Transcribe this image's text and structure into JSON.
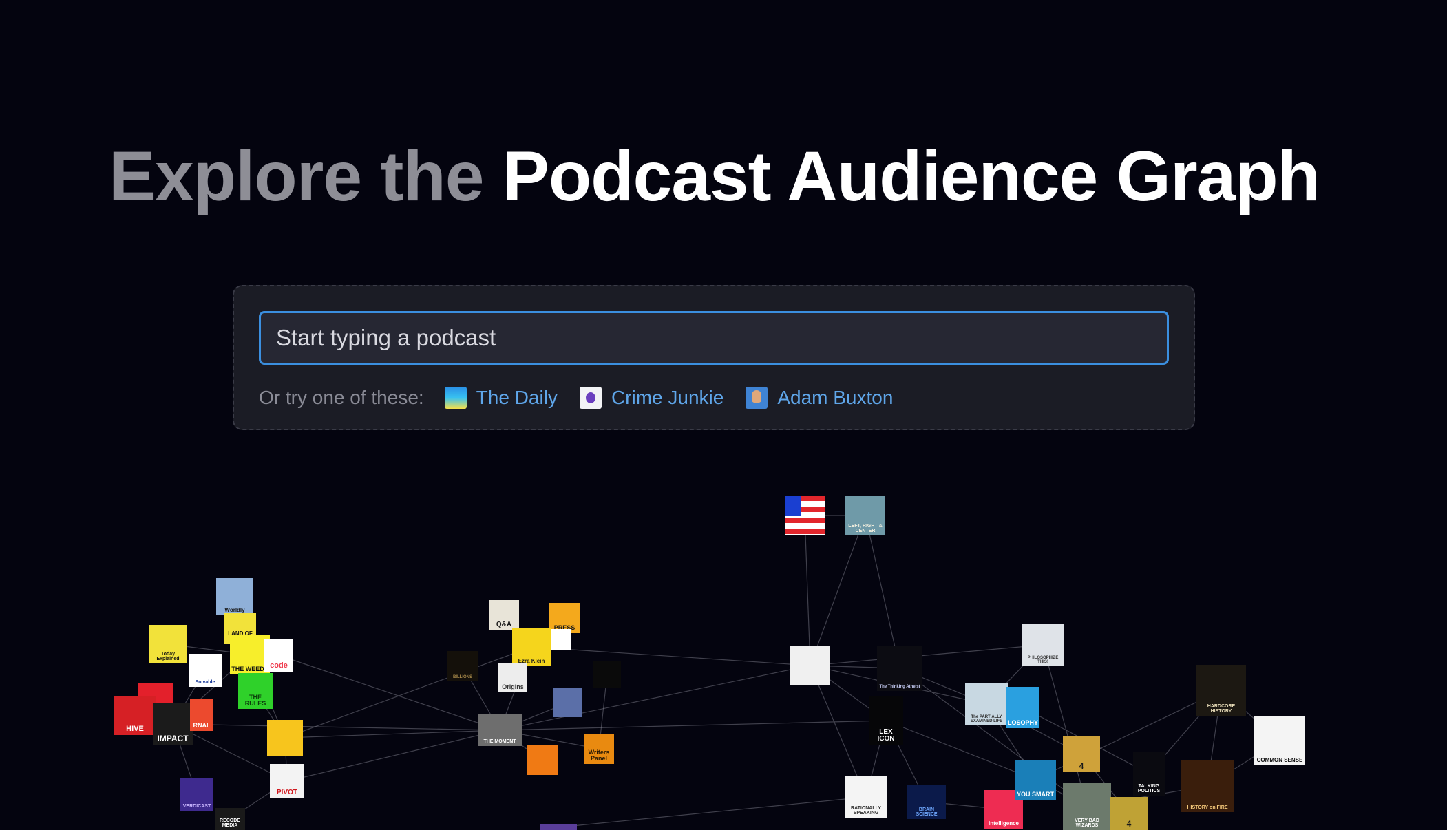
{
  "hero": {
    "title_muted": "Explore the",
    "title_bright": "Podcast Audience Graph"
  },
  "search": {
    "placeholder": "Start typing a podcast",
    "value": "",
    "suggestions_label": "Or try one of these:",
    "suggestions": [
      {
        "label": "The Daily",
        "icon": "the-daily-cover"
      },
      {
        "label": "Crime Junkie",
        "icon": "crime-junkie-cover"
      },
      {
        "label": "Adam Buxton",
        "icon": "adam-buxton-cover"
      }
    ]
  },
  "graph": {
    "edge_color": "#8a8a96",
    "nodes": [
      {
        "id": "flag",
        "name": "podcast-cover-flag",
        "label": "",
        "bg": "#1a3fd1",
        "fg": "#ffffff"
      },
      {
        "id": "left-right",
        "name": "podcast-cover-left-right-center",
        "label": "LEFT, RIGHT & CENTER",
        "bg": "#6f9aa8",
        "fg": "#f4f0e0"
      },
      {
        "id": "worldly",
        "name": "podcast-cover-worldly",
        "label": "Worldly",
        "bg": "#8fb0d8",
        "fg": "#1a1a1a"
      },
      {
        "id": "today-explained",
        "name": "podcast-cover-today-explained",
        "label": "Today Explained",
        "bg": "#f2e23a",
        "fg": "#111111"
      },
      {
        "id": "land-of-giants",
        "name": "podcast-cover-land-of-the-giants",
        "label": "LAND OF THE",
        "bg": "#f2e23a",
        "fg": "#111111"
      },
      {
        "id": "the-weeds",
        "name": "podcast-cover-the-weeds",
        "label": "THE WEEDS",
        "bg": "#f7ee2b",
        "fg": "#111111"
      },
      {
        "id": "recode",
        "name": "podcast-cover-recode",
        "label": "code",
        "bg": "#ffffff",
        "fg": "#ef3a4c"
      },
      {
        "id": "solvable",
        "name": "podcast-cover-solvable",
        "label": "Solvable",
        "bg": "#ffffff",
        "fg": "#1a3a9a"
      },
      {
        "id": "against-rules",
        "name": "podcast-cover-against-the-rules",
        "label": "THE RULES",
        "bg": "#2fd12a",
        "fg": "#0b3d0b"
      },
      {
        "id": "red-q",
        "name": "podcast-cover-red",
        "label": "",
        "bg": "#e3202b",
        "fg": "#ffffff"
      },
      {
        "id": "hive",
        "name": "podcast-cover-inside-the-hive",
        "label": "HIVE",
        "bg": "#d62025",
        "fg": "#ffffff"
      },
      {
        "id": "impact",
        "name": "podcast-cover-impact",
        "label": "IMPACT",
        "bg": "#1b1b1b",
        "fg": "#ffffff"
      },
      {
        "id": "journal",
        "name": "podcast-cover-the-journal",
        "label": "RNAL",
        "bg": "#ec4a2e",
        "fg": "#ffffff"
      },
      {
        "id": "yellow-circle",
        "name": "podcast-cover-yellow",
        "label": "",
        "bg": "#f7c51d",
        "fg": "#c9302a"
      },
      {
        "id": "pivot",
        "name": "podcast-cover-pivot",
        "label": "PIVOT",
        "bg": "#f3f3f3",
        "fg": "#d0161c"
      },
      {
        "id": "verdict",
        "name": "podcast-cover-verdict",
        "label": "VERDICAST",
        "bg": "#3e2a8e",
        "fg": "#c9b6ff"
      },
      {
        "id": "recode-media",
        "name": "podcast-cover-recode-media",
        "label": "RECODE MEDIA",
        "bg": "#1a1a1a",
        "fg": "#ffffff"
      },
      {
        "id": "qanda",
        "name": "podcast-cover-q-and-a",
        "label": "Q&A",
        "bg": "#e8e4d8",
        "fg": "#1a1a1a"
      },
      {
        "id": "press-box",
        "name": "podcast-cover-press-box",
        "label": "PRESS",
        "bg": "#f4a91c",
        "fg": "#1a1a1a"
      },
      {
        "id": "ezra",
        "name": "podcast-cover-ezra-klein",
        "label": "Ezra Klein",
        "bg": "#f5d51c",
        "fg": "#1a1a1a"
      },
      {
        "id": "billions",
        "name": "podcast-cover-billions",
        "label": "BILLIONS",
        "bg": "#14100a",
        "fg": "#a88a4a"
      },
      {
        "id": "origins",
        "name": "podcast-cover-origins",
        "label": "Origins",
        "bg": "#ededed",
        "fg": "#333333"
      },
      {
        "id": "recode-right",
        "name": "podcast-cover-white-small",
        "label": "",
        "bg": "#ffffff",
        "fg": "#333333"
      },
      {
        "id": "the-ringer",
        "name": "podcast-cover-the-ringer",
        "label": "",
        "bg": "#0a0a0a",
        "fg": "#ffffff"
      },
      {
        "id": "ringer-show",
        "name": "podcast-cover-ringer-show",
        "label": "",
        "bg": "#5b6fa8",
        "fg": "#ffffff"
      },
      {
        "id": "the-moment",
        "name": "podcast-cover-the-moment",
        "label": "THE MOMENT",
        "bg": "#6e6e6e",
        "fg": "#ffffff"
      },
      {
        "id": "orange-ringer",
        "name": "podcast-cover-orange",
        "label": "",
        "bg": "#f07a14",
        "fg": "#1a1a1a"
      },
      {
        "id": "writers-panel",
        "name": "podcast-cover-writers-panel",
        "label": "Writers Panel",
        "bg": "#e98a10",
        "fg": "#2a1a05"
      },
      {
        "id": "intelligence",
        "name": "podcast-cover-intelligence-squared",
        "label": "",
        "bg": "#f0f0f0",
        "fg": "#c0202a"
      },
      {
        "id": "thinking-atheist",
        "name": "podcast-cover-the-thinking-atheist",
        "label": "The Thinking Atheist",
        "bg": "#0c0c12",
        "fg": "#cfd6ff"
      },
      {
        "id": "lex",
        "name": "podcast-cover-lex-icon-valley",
        "label": "LEX ICON",
        "bg": "#060608",
        "fg": "#ffffff"
      },
      {
        "id": "philosophize",
        "name": "podcast-cover-philosophize-this",
        "label": "PHILOSOPHIZE THIS!",
        "bg": "#dfe3e8",
        "fg": "#333333"
      },
      {
        "id": "partially-examined",
        "name": "podcast-cover-the-partially-examined-life",
        "label": "The PARTIALLY EXAMINED LIFE",
        "bg": "#c8d8e2",
        "fg": "#2a2a2a"
      },
      {
        "id": "philosophy",
        "name": "podcast-cover-philosophy",
        "label": "LOSOPHY",
        "bg": "#2aa0e0",
        "fg": "#ffffff"
      },
      {
        "id": "rationally",
        "name": "podcast-cover-rationally-speaking",
        "label": "RATIONALLY SPEAKING",
        "bg": "#f4f4f4",
        "fg": "#333333"
      },
      {
        "id": "brain-science",
        "name": "podcast-cover-brain-science",
        "label": "BRAIN SCIENCE",
        "bg": "#0b1a4a",
        "fg": "#6fa8ff"
      },
      {
        "id": "intelligence2",
        "name": "podcast-cover-intelligence-squared-red",
        "label": "intelligence",
        "bg": "#ee2c52",
        "fg": "#ffffff"
      },
      {
        "id": "you-are-smart",
        "name": "podcast-cover-you-are-not-so-smart",
        "label": "YOU SMART",
        "bg": "#1a7fb8",
        "fg": "#ffffff"
      },
      {
        "id": "radio4",
        "name": "podcast-cover-bbc-radio-4",
        "label": "4",
        "bg": "#cfa23a",
        "fg": "#1a1a1a"
      },
      {
        "id": "very-bad-wizards",
        "name": "podcast-cover-very-bad-wizards",
        "label": "VERY BAD WIZARDS",
        "bg": "#6c7a6c",
        "fg": "#ffffff"
      },
      {
        "id": "radio4b",
        "name": "podcast-cover-radio-4-gold",
        "label": "4",
        "bg": "#bfa235",
        "fg": "#1a1a1a"
      },
      {
        "id": "talking-politics",
        "name": "podcast-cover-talking-politics",
        "label": "TALKING POLITICS",
        "bg": "#0a0a10",
        "fg": "#ffffff"
      },
      {
        "id": "hardcore-history",
        "name": "podcast-cover-hardcore-history",
        "label": "HARDCORE HISTORY",
        "bg": "#1c1812",
        "fg": "#e8dcb8"
      },
      {
        "id": "common-sense",
        "name": "podcast-cover-common-sense",
        "label": "COMMON SENSE",
        "bg": "#f4f4f4",
        "fg": "#111111"
      },
      {
        "id": "history-on-fire",
        "name": "podcast-cover-history-on-fire",
        "label": "HISTORY on FIRE",
        "bg": "#3a1e0c",
        "fg": "#f4c87a"
      },
      {
        "id": "purple-bottom",
        "name": "podcast-cover-purple",
        "label": "",
        "bg": "#5a3e9a",
        "fg": "#ffffff"
      }
    ]
  }
}
